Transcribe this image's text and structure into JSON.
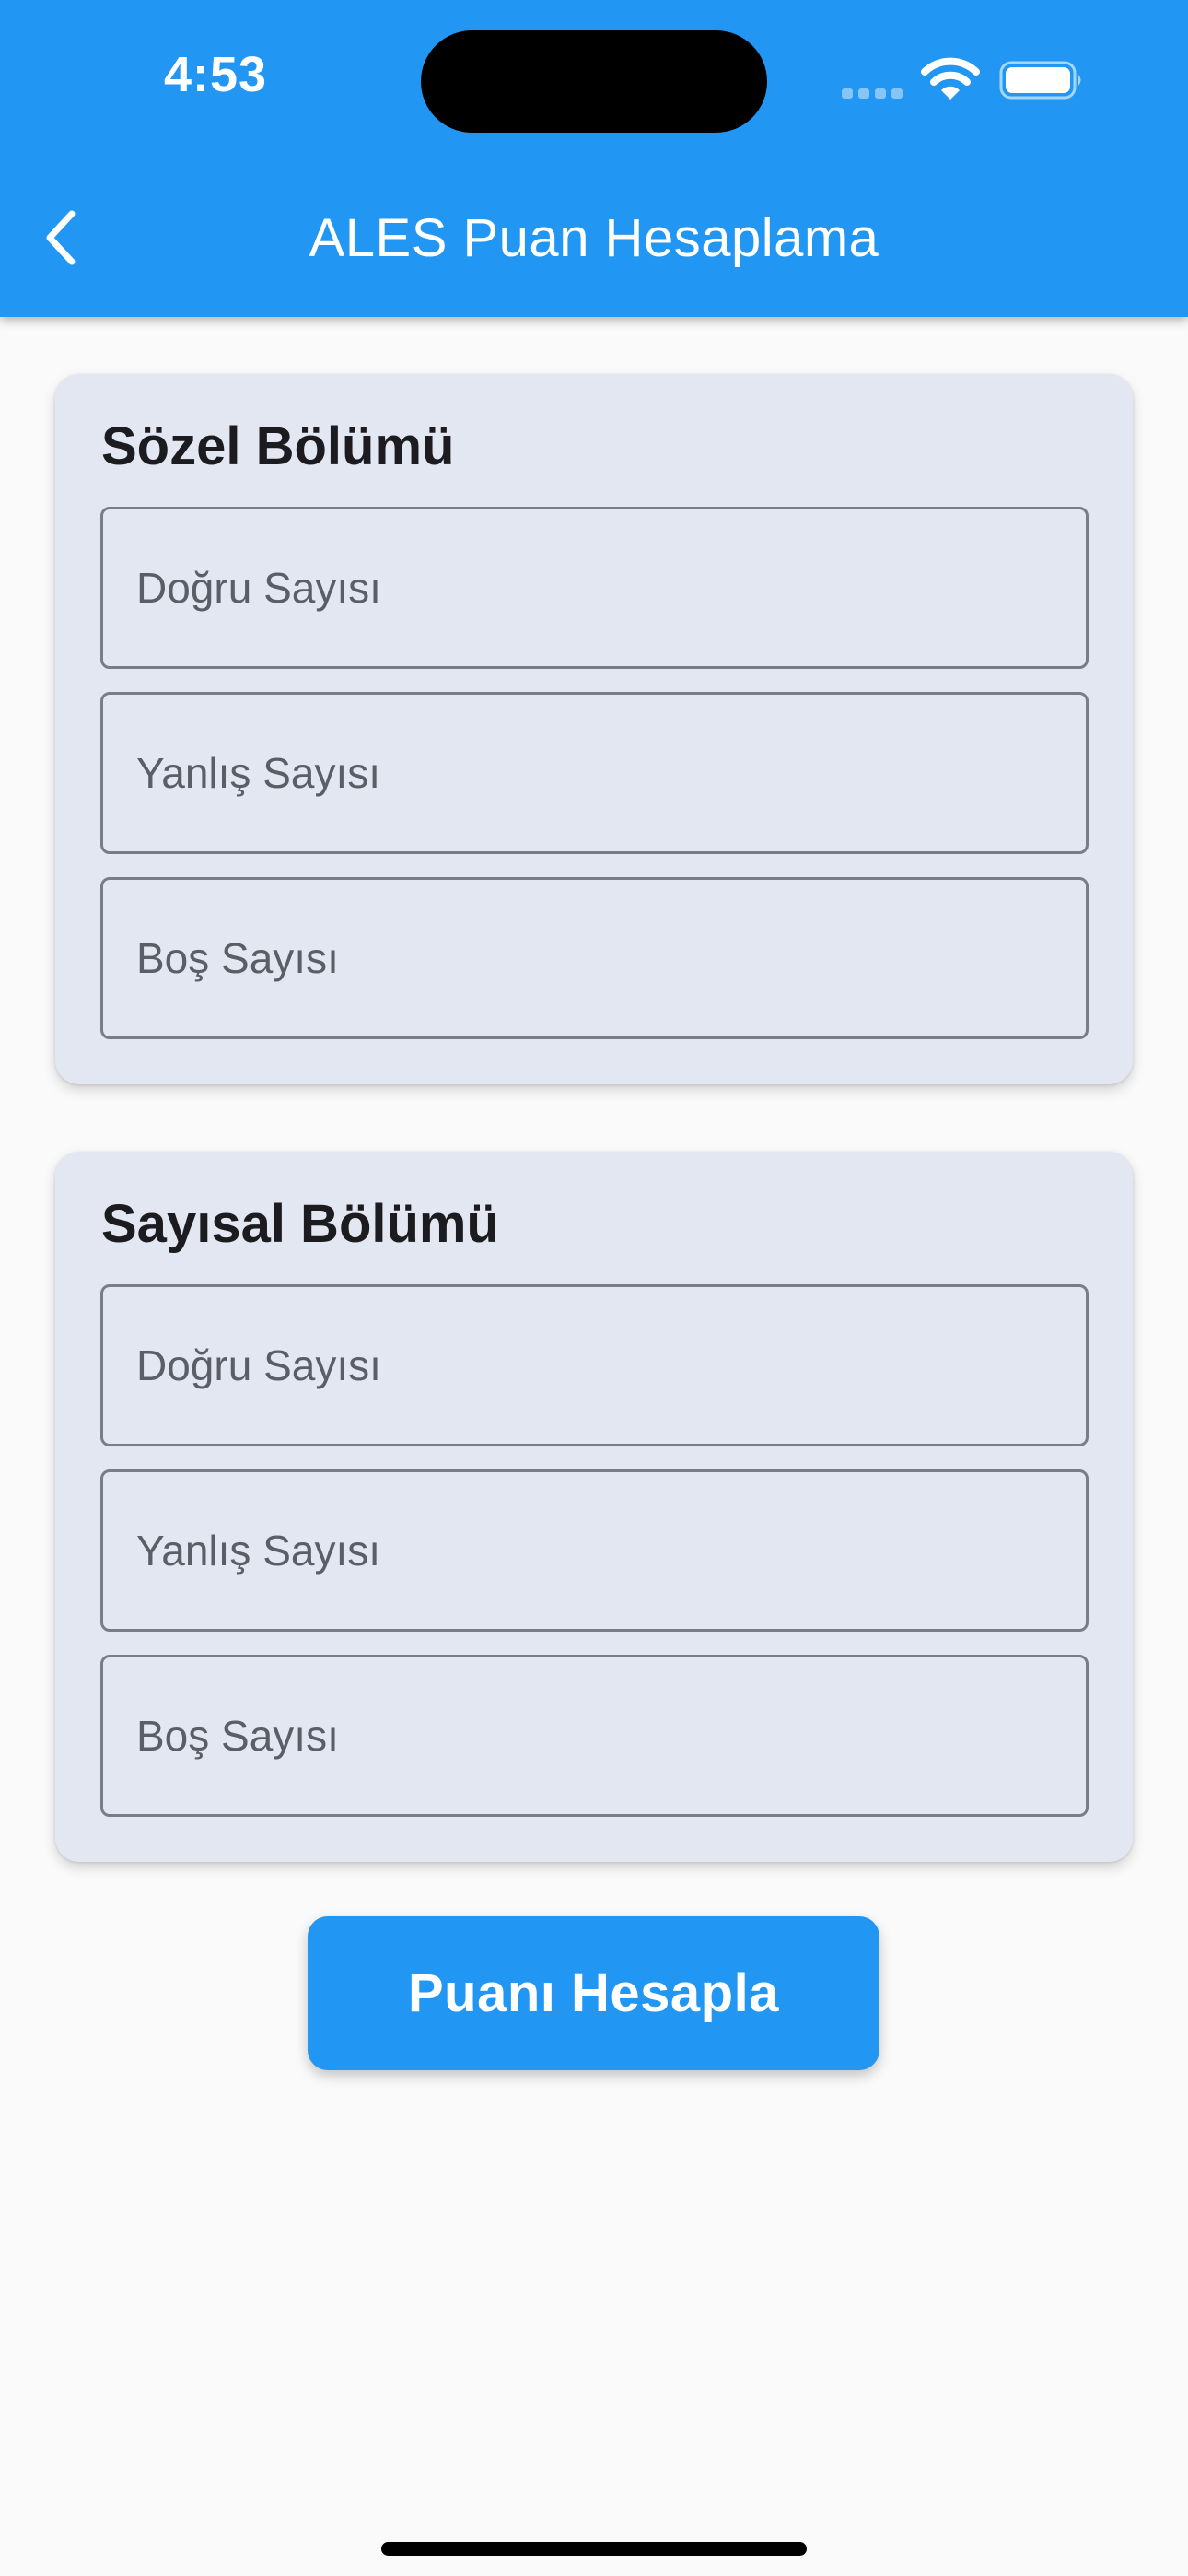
{
  "status_bar": {
    "time": "4:53"
  },
  "app_bar": {
    "title": "ALES Puan Hesaplama",
    "back_icon": "chevron-left-icon"
  },
  "sections": [
    {
      "title": "Sözel Bölümü",
      "fields": [
        {
          "placeholder": "Doğru Sayısı",
          "value": ""
        },
        {
          "placeholder": "Yanlış Sayısı",
          "value": ""
        },
        {
          "placeholder": "Boş Sayısı",
          "value": ""
        }
      ]
    },
    {
      "title": "Sayısal Bölümü",
      "fields": [
        {
          "placeholder": "Doğru Sayısı",
          "value": ""
        },
        {
          "placeholder": "Yanlış Sayısı",
          "value": ""
        },
        {
          "placeholder": "Boş Sayısı",
          "value": ""
        }
      ]
    }
  ],
  "calculate_button": {
    "label": "Puanı Hesapla"
  },
  "colors": {
    "primary": "#2196f3",
    "card_background": "#e2e7f2",
    "page_background": "#fafafa"
  }
}
